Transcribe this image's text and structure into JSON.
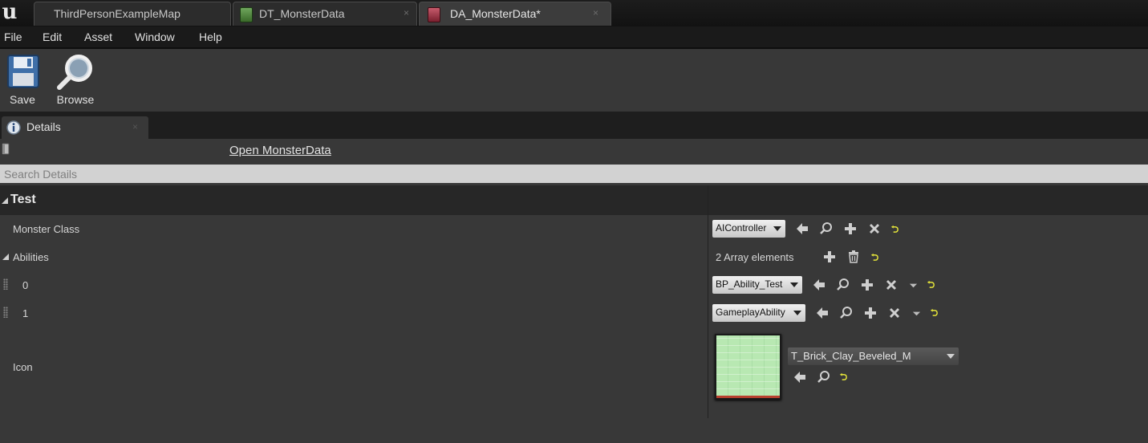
{
  "title_bar": {
    "logo": "u",
    "tabs": [
      {
        "label": "ThirdPersonExampleMap",
        "close": ""
      },
      {
        "label": "DT_MonsterData",
        "close": "×"
      },
      {
        "label": "DA_MonsterData*",
        "close": "×"
      }
    ]
  },
  "menu": {
    "items": [
      "File",
      "Edit",
      "Asset",
      "Window",
      "Help"
    ]
  },
  "toolbar": {
    "save_label": "Save",
    "browse_label": "Browse"
  },
  "details": {
    "tab_label": "Details",
    "tab_close": "×",
    "open_link": "Open MonsterData",
    "search_placeholder": "Search Details",
    "category": "Test",
    "rows": {
      "monster_class": {
        "label": "Monster Class",
        "value": "AIController"
      },
      "abilities": {
        "label": "Abilities",
        "value": "2 Array elements"
      },
      "element_0": {
        "label": "0",
        "value": "BP_Ability_Test"
      },
      "element_1": {
        "label": "1",
        "value": "GameplayAbility"
      },
      "icon": {
        "label": "Icon",
        "value": "T_Brick_Clay_Beveled_M"
      }
    }
  },
  "icons": [
    "save-icon",
    "browse-icon",
    "use-selected-icon",
    "browse-asset-icon",
    "add-icon",
    "clear-icon",
    "reset-to-default-icon",
    "delete-icon",
    "dropdown-icon"
  ],
  "colors": {
    "accent_reset": "#e5e53a",
    "texture_green": "#b6e8b0",
    "data_table_tab": "#4a8a3a",
    "data_asset_tab": "#a23a4a"
  }
}
